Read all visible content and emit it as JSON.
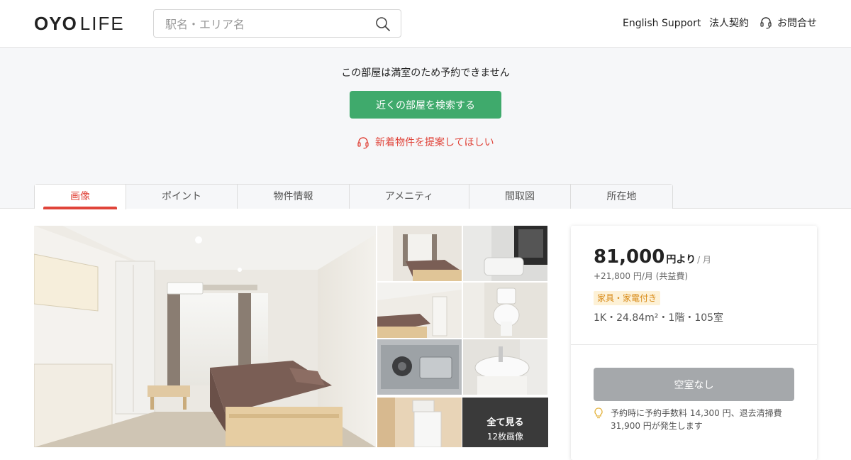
{
  "header": {
    "logo_main": "OYO",
    "logo_sub": "LIFE",
    "search_placeholder": "駅名・エリア名",
    "nav": {
      "english": "English Support",
      "corporate": "法人契約",
      "contact": "お問合せ"
    }
  },
  "notice": {
    "message": "この部屋は満室のため予約できません",
    "search_button": "近くの部屋を検索する",
    "suggest_link": "新着物件を提案してほしい"
  },
  "tabs": [
    {
      "label": "画像",
      "active": true
    },
    {
      "label": "ポイント",
      "active": false
    },
    {
      "label": "物件情報",
      "active": false
    },
    {
      "label": "アメニティ",
      "active": false
    },
    {
      "label": "間取図",
      "active": false
    },
    {
      "label": "所在地",
      "active": false
    }
  ],
  "gallery": {
    "see_all": "全て見る",
    "image_count": "12枚画像"
  },
  "listing": {
    "price": "81,000",
    "price_unit": "円より",
    "price_period": "/ 月",
    "common_fee": "+21,800 円/月 (共益費)",
    "badge": "家具・家電付き",
    "spec": "1K・24.84m²・1階・105室",
    "vacancy_button": "空室なし",
    "fee_note": "予約時に予約手数料 14,300 円、退去清掃費 31,900 円が発生します"
  },
  "colors": {
    "accent_red": "#e0443a",
    "button_green": "#3faa6c",
    "badge_bg": "#fdf1d6",
    "badge_text": "#d88a17"
  }
}
